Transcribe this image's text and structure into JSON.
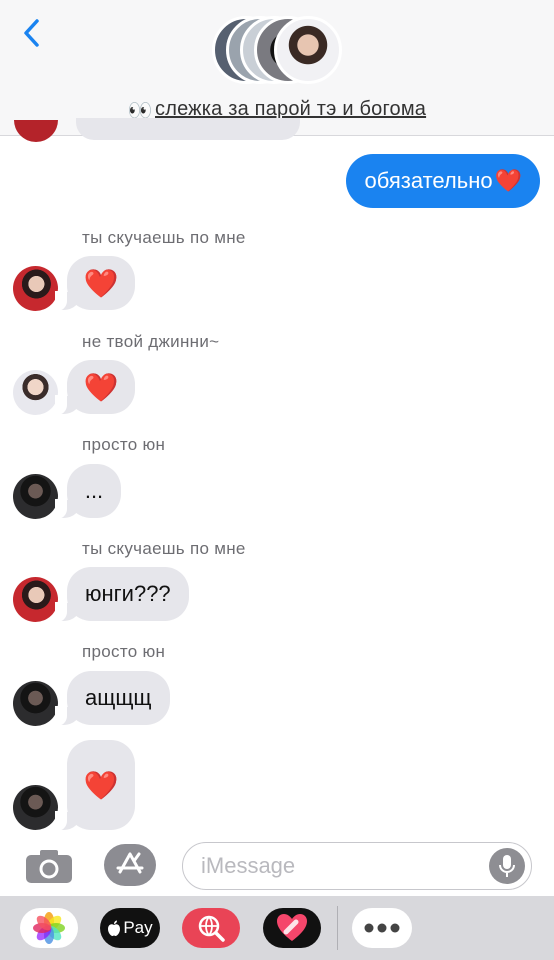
{
  "header": {
    "group_name": "слежка за парой тэ и богома",
    "group_emoji": "👀"
  },
  "messages": {
    "sent_1": {
      "text": "обязательно",
      "emoji": "❤️"
    },
    "thread": [
      {
        "sender": "ты скучаешь по мне",
        "text": "❤️",
        "avatar": "red-outfit"
      },
      {
        "sender": "не твой джинни~",
        "text": "❤️",
        "avatar": "white-shirt"
      },
      {
        "sender": "просто юн",
        "text": "...",
        "avatar": "dark-hair"
      },
      {
        "sender": "ты скучаешь по мне",
        "text": "юнги???",
        "avatar": "red-outfit"
      },
      {
        "sender": "просто юн",
        "text": "ащщщ",
        "avatar": "dark-hair"
      },
      {
        "text": "❤️",
        "avatar": "dark-hair"
      }
    ]
  },
  "composer": {
    "placeholder": "iMessage",
    "value": ""
  },
  "app_strip": {
    "apple_pay_label": "Pay"
  },
  "colors": {
    "sent_bubble": "#1a83f0",
    "received_bubble": "#e6e6eb",
    "back_chevron": "#1a83f0"
  },
  "icons": [
    "back-chevron-icon",
    "camera-icon",
    "app-store-icon",
    "microphone-icon",
    "photos-icon",
    "apple-pay-icon",
    "globe-search-icon",
    "heart-stickers-icon",
    "more-icon"
  ]
}
